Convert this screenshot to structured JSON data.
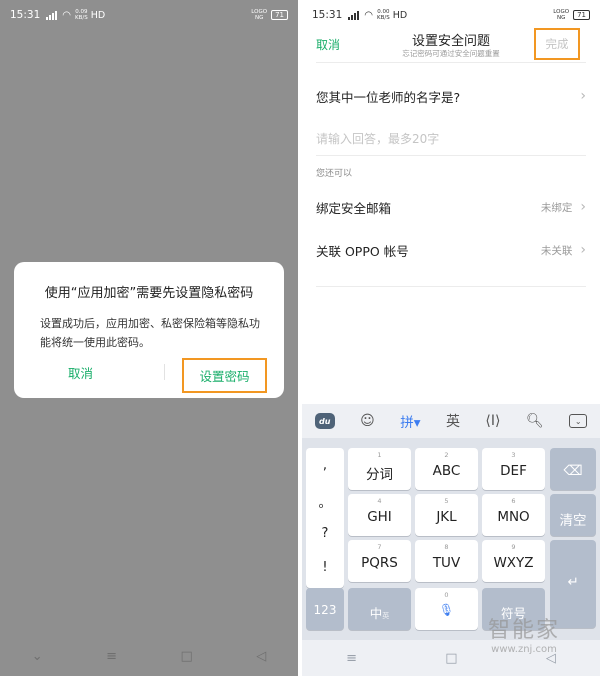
{
  "left": {
    "status": {
      "time": "15:31",
      "speed_top": "0.09",
      "speed_unit": "KB/S",
      "hd": "HD",
      "logo_top": "LOGO",
      "logo_bottom": "NG",
      "battery": "71"
    },
    "dialog": {
      "title": "使用“应用加密”需要先设置隐私密码",
      "message": "设置成功后，应用加密、私密保险箱等隐私功能将统一使用此密码。",
      "cancel": "取消",
      "confirm": "设置密码"
    },
    "nav": {
      "menu_icon": "menu-icon",
      "home_icon": "home-icon",
      "back_icon": "back-icon"
    }
  },
  "right": {
    "status": {
      "time": "15:31",
      "speed_top": "0.00",
      "speed_unit": "KB/S",
      "hd": "HD",
      "logo_top": "LOGO",
      "logo_bottom": "NG",
      "battery": "71"
    },
    "header": {
      "cancel": "取消",
      "title": "设置安全问题",
      "subtitle": "忘记密码可通过安全问题重置",
      "done": "完成"
    },
    "question": "您其中一位老师的名字是?",
    "answer_placeholder": "请输入回答，最多20字",
    "also_label": "您还可以",
    "email": {
      "label": "绑定安全邮箱",
      "value": "未绑定"
    },
    "oppo": {
      "label": "关联 OPPO 帐号",
      "value": "未关联"
    },
    "keyboard": {
      "toolbar": {
        "du": "du",
        "pinyin": "拼",
        "english": "英"
      },
      "punct": [
        ",",
        "。",
        "?",
        "!"
      ],
      "keys": [
        {
          "num": "1",
          "label": "分词"
        },
        {
          "num": "2",
          "label": "ABC"
        },
        {
          "num": "3",
          "label": "DEF"
        },
        {
          "num": "4",
          "label": "GHI"
        },
        {
          "num": "5",
          "label": "JKL"
        },
        {
          "num": "6",
          "label": "MNO"
        },
        {
          "num": "7",
          "label": "PQRS"
        },
        {
          "num": "8",
          "label": "TUV"
        },
        {
          "num": "9",
          "label": "WXYZ"
        }
      ],
      "clear": "清空",
      "num_key": "123",
      "zh_key": "中",
      "zh_sub": "英",
      "symbol_key": "符号",
      "zero": "0"
    }
  },
  "watermark": {
    "cn": "智能家",
    "url": "www.znj.com"
  },
  "colors": {
    "accent_green": "#1aae6a",
    "highlight_orange": "#f29722",
    "overlay_gray": "#8f8f8f"
  }
}
